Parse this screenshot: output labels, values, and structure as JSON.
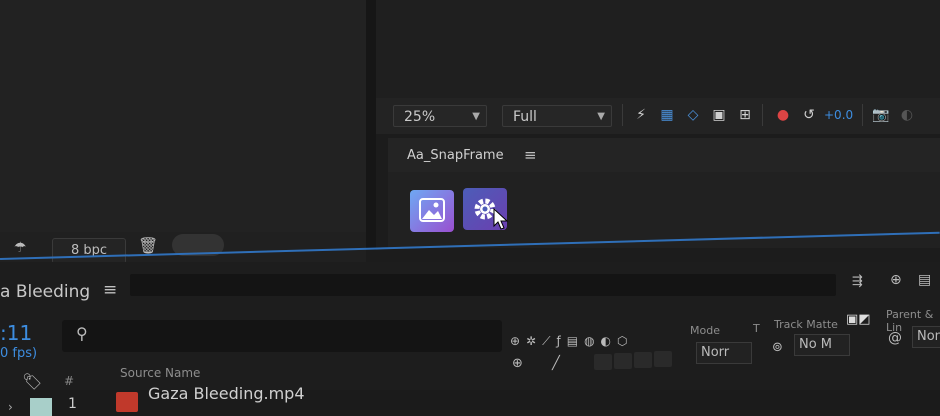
{
  "viewer": {
    "zoom": "25%",
    "resolution": "Full",
    "exposure": "+0.0"
  },
  "left_panel": {
    "bit_depth": "8 bpc"
  },
  "snapframe": {
    "title": "Aa_SnapFrame",
    "menu_icon": "hamburger-icon",
    "buttons": [
      "image-icon",
      "gear-icon"
    ]
  },
  "timeline": {
    "comp_name": "a Bleeding",
    "menu_icon": "hamburger-icon",
    "timecode": ":11",
    "fps": "0 fps)",
    "columns": {
      "source_name": "Source Name",
      "mode": "Mode",
      "t": "T",
      "track_matte": "Track Matte",
      "parent": "Parent & Lin"
    },
    "layers": [
      {
        "index": "1",
        "name": "Gaza Bleeding.mp4",
        "mode": "Norr",
        "matte": "No M",
        "parent": "Non"
      }
    ]
  },
  "colors": {
    "accent_blue": "#2f6fb8",
    "timecode_blue": "#3d8de0",
    "label_teal": "#a8cfc9"
  }
}
